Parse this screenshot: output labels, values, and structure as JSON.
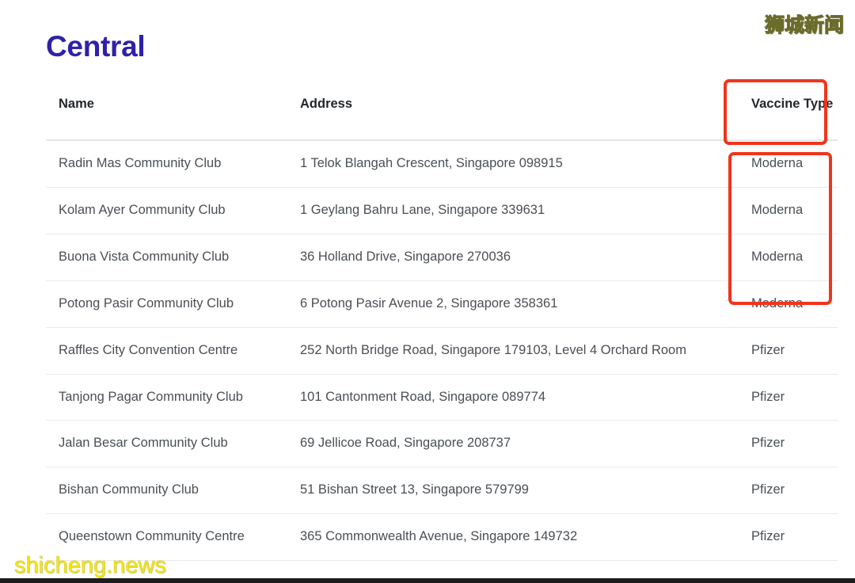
{
  "page": {
    "title": "Central",
    "title_color": "#2e21a8",
    "background_color": "#ffffff"
  },
  "table": {
    "columns": [
      {
        "key": "name",
        "label": "Name"
      },
      {
        "key": "address",
        "label": "Address"
      },
      {
        "key": "vaccine_type",
        "label": "Vaccine Type"
      }
    ],
    "rows": [
      {
        "name": "Radin Mas Community Club",
        "address": "1 Telok Blangah Crescent, Singapore 098915",
        "vaccine_type": "Moderna"
      },
      {
        "name": "Kolam Ayer Community Club",
        "address": "1 Geylang Bahru Lane, Singapore 339631",
        "vaccine_type": "Moderna"
      },
      {
        "name": "Buona Vista Community Club",
        "address": "36 Holland Drive, Singapore 270036",
        "vaccine_type": "Moderna"
      },
      {
        "name": "Potong Pasir Community Club",
        "address": "6 Potong Pasir Avenue 2, Singapore 358361",
        "vaccine_type": "Moderna"
      },
      {
        "name": "Raffles City Convention Centre",
        "address": "252 North Bridge Road, Singapore 179103, Level 4 Orchard Room",
        "vaccine_type": "Pfizer"
      },
      {
        "name": "Tanjong Pagar Community Club",
        "address": "101 Cantonment Road, Singapore 089774",
        "vaccine_type": "Pfizer"
      },
      {
        "name": "Jalan Besar Community Club",
        "address": "69 Jellicoe Road, Singapore 208737",
        "vaccine_type": "Pfizer"
      },
      {
        "name": "Bishan Community Club",
        "address": "51 Bishan Street 13, Singapore 579799",
        "vaccine_type": "Pfizer"
      },
      {
        "name": "Queenstown Community Centre",
        "address": "365 Commonwealth Avenue, Singapore 149732",
        "vaccine_type": "Pfizer"
      }
    ]
  },
  "annotations": {
    "color": "#f0351b",
    "boxes": [
      {
        "name": "vaccine-type-header-highlight",
        "target": "Vaccine Type"
      },
      {
        "name": "moderna-rows-highlight",
        "target": "Moderna"
      }
    ]
  },
  "watermarks": {
    "top_right": "狮城新闻",
    "bottom_left": "shicheng.news",
    "color": "#ffe800"
  }
}
